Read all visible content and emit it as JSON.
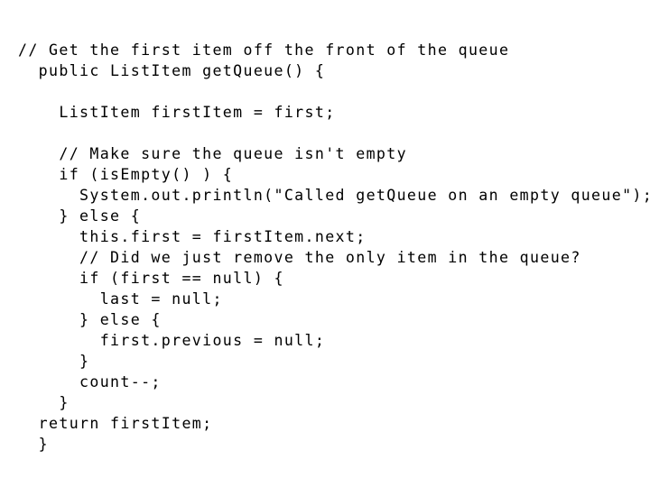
{
  "slide": {
    "background_color": "#ffffff",
    "text_color": "#000000",
    "language": "java",
    "title": "Get the first item off the front of the queue"
  },
  "code": {
    "lines": [
      "// Get the first item off the front of the queue",
      "  public ListItem getQueue() {",
      "",
      "    ListItem firstItem = first;",
      "",
      "    // Make sure the queue isn't empty",
      "    if (isEmpty() ) {",
      "      System.out.println(\"Called getQueue on an empty queue\");",
      "    } else {",
      "      this.first = firstItem.next;",
      "      // Did we just remove the only item in the queue?",
      "      if (first == null) {",
      "        last = null;",
      "      } else {",
      "        first.previous = null;",
      "      }",
      "      count--;",
      "    }",
      "  return firstItem;",
      "  }"
    ]
  }
}
